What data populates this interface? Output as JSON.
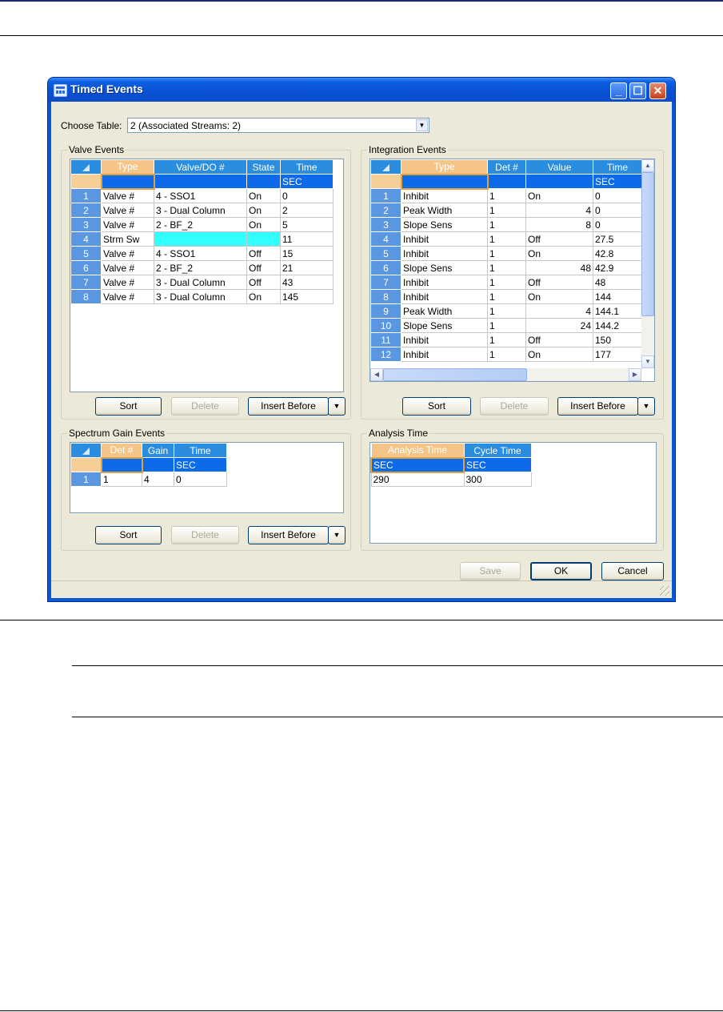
{
  "window": {
    "title": "Timed Events"
  },
  "choose_table": {
    "label": "Choose Table:",
    "value": "2 (Associated Streams: 2)"
  },
  "valve_events": {
    "title": "Valve Events",
    "columns": [
      "Type",
      "Valve/DO #",
      "State",
      "Time"
    ],
    "units": [
      "",
      "",
      "",
      "SEC"
    ],
    "rows": [
      {
        "n": "1",
        "type": "Valve #",
        "valve": "4 - SSO1",
        "state": "On",
        "time": "0"
      },
      {
        "n": "2",
        "type": "Valve #",
        "valve": "3 - Dual Column",
        "state": "On",
        "time": "2"
      },
      {
        "n": "3",
        "type": "Valve #",
        "valve": "2 - BF_2",
        "state": "On",
        "time": "5"
      },
      {
        "n": "4",
        "type": "Strm Sw",
        "valve": "",
        "state": "",
        "time": "11"
      },
      {
        "n": "5",
        "type": "Valve #",
        "valve": "4 - SSO1",
        "state": "Off",
        "time": "15"
      },
      {
        "n": "6",
        "type": "Valve #",
        "valve": "2 - BF_2",
        "state": "Off",
        "time": "21"
      },
      {
        "n": "7",
        "type": "Valve #",
        "valve": "3 - Dual Column",
        "state": "Off",
        "time": "43"
      },
      {
        "n": "8",
        "type": "Valve #",
        "valve": "3 - Dual Column",
        "state": "On",
        "time": "145"
      }
    ],
    "buttons": {
      "sort": "Sort",
      "delete": "Delete",
      "insert": "Insert Before"
    }
  },
  "integration_events": {
    "title": "Integration Events",
    "columns": [
      "Type",
      "Det #",
      "Value",
      "Time"
    ],
    "units": [
      "",
      "",
      "",
      "SEC"
    ],
    "rows": [
      {
        "n": "1",
        "type": "Inhibit",
        "det": "1",
        "value": "On",
        "time": "0"
      },
      {
        "n": "2",
        "type": "Peak Width",
        "det": "1",
        "value": "4",
        "time": "0"
      },
      {
        "n": "3",
        "type": "Slope Sens",
        "det": "1",
        "value": "8",
        "time": "0"
      },
      {
        "n": "4",
        "type": "Inhibit",
        "det": "1",
        "value": "Off",
        "time": "27.5"
      },
      {
        "n": "5",
        "type": "Inhibit",
        "det": "1",
        "value": "On",
        "time": "42.8"
      },
      {
        "n": "6",
        "type": "Slope Sens",
        "det": "1",
        "value": "48",
        "time": "42.9"
      },
      {
        "n": "7",
        "type": "Inhibit",
        "det": "1",
        "value": "Off",
        "time": "48"
      },
      {
        "n": "8",
        "type": "Inhibit",
        "det": "1",
        "value": "On",
        "time": "144"
      },
      {
        "n": "9",
        "type": "Peak Width",
        "det": "1",
        "value": "4",
        "time": "144.1"
      },
      {
        "n": "10",
        "type": "Slope Sens",
        "det": "1",
        "value": "24",
        "time": "144.2"
      },
      {
        "n": "11",
        "type": "Inhibit",
        "det": "1",
        "value": "Off",
        "time": "150"
      },
      {
        "n": "12",
        "type": "Inhibit",
        "det": "1",
        "value": "On",
        "time": "177"
      }
    ],
    "buttons": {
      "sort": "Sort",
      "delete": "Delete",
      "insert": "Insert Before"
    }
  },
  "spectrum_gain_events": {
    "title": "Spectrum Gain Events",
    "columns": [
      "Det #",
      "Gain",
      "Time"
    ],
    "units": [
      "",
      "",
      "SEC"
    ],
    "rows": [
      {
        "n": "1",
        "det": "1",
        "gain": "4",
        "time": "0"
      }
    ],
    "buttons": {
      "sort": "Sort",
      "delete": "Delete",
      "insert": "Insert Before"
    }
  },
  "analysis_time": {
    "title": "Analysis Time",
    "columns": [
      "Analysis Time",
      "Cycle Time"
    ],
    "units": [
      "SEC",
      "SEC"
    ],
    "values": [
      "290",
      "300"
    ]
  },
  "footer_buttons": {
    "save": "Save",
    "ok": "OK",
    "cancel": "Cancel"
  }
}
